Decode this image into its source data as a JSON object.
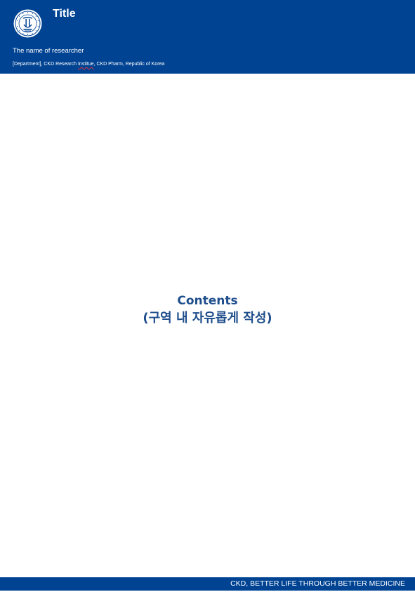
{
  "header": {
    "title": "Title",
    "researcher": "The name of researcher",
    "affiliation_before": "[Department], CKD Research ",
    "affiliation_flagged": "Institue",
    "affiliation_after": ", CKD Pharm, Republic of Korea",
    "background_color": "#004393",
    "logo_icon": "ckd-emblem-icon"
  },
  "body": {
    "contents_heading": "Contents",
    "contents_subheading": "(구역 내 자유롭게 작성)",
    "heading_color": "#1f4e8c"
  },
  "footer": {
    "slogan": "CKD, BETTER LIFE THROUGH BETTER MEDICINE"
  }
}
